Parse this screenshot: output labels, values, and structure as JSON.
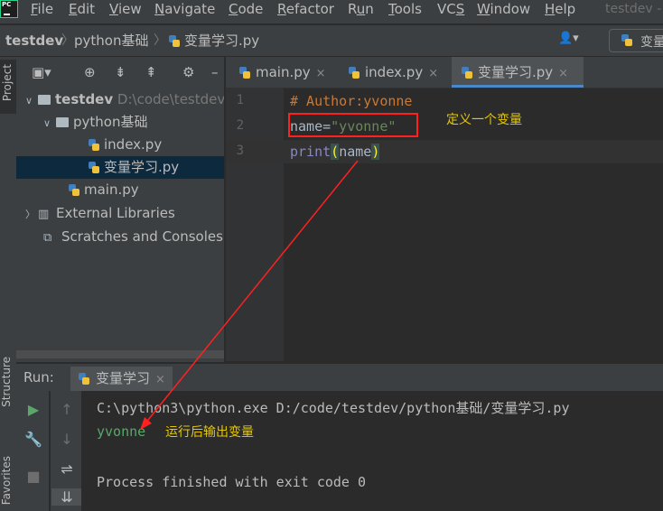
{
  "menubar": {
    "logo": "PC",
    "items": [
      {
        "pre": "",
        "u": "F",
        "post": "ile"
      },
      {
        "pre": "",
        "u": "E",
        "post": "dit"
      },
      {
        "pre": "",
        "u": "V",
        "post": "iew"
      },
      {
        "pre": "",
        "u": "N",
        "post": "avigate"
      },
      {
        "pre": "",
        "u": "C",
        "post": "ode"
      },
      {
        "pre": "",
        "u": "R",
        "post": "efactor"
      },
      {
        "pre": "R",
        "u": "u",
        "post": "n"
      },
      {
        "pre": "",
        "u": "T",
        "post": "ools"
      },
      {
        "pre": "VC",
        "u": "S",
        "post": ""
      },
      {
        "pre": "",
        "u": "W",
        "post": "indow"
      },
      {
        "pre": "",
        "u": "H",
        "post": "elp"
      }
    ],
    "window_title": "testdev -"
  },
  "breadcrumb": {
    "items": [
      "testdev",
      "python基础",
      "变量学习.py"
    ],
    "run_config_label": "变量"
  },
  "side_labels": {
    "project": "Project",
    "structure": "Structure",
    "favorites": "Favorites"
  },
  "project_tree": {
    "root_name": "testdev",
    "root_path": "D:\\code\\testdev",
    "folder": "python基础",
    "files": [
      "index.py",
      "变量学习.py"
    ],
    "main_file": "main.py",
    "external_libraries": "External Libraries",
    "scratches": "Scratches and Consoles"
  },
  "editor_tabs": [
    {
      "label": "main.py",
      "active": false
    },
    {
      "label": "index.py",
      "active": false
    },
    {
      "label": "变量学习.py",
      "active": true
    }
  ],
  "code": {
    "line_numbers": [
      "1",
      "2",
      "3"
    ],
    "line1_comment": "# Author:yvonne",
    "line2_name": "name",
    "line2_eq": "=",
    "line2_string": "\"yvonne\"",
    "line3_print": "print",
    "line3_open": "(",
    "line3_arg": "name",
    "line3_close": ")"
  },
  "annotations": {
    "define_variable": "定义一个变量",
    "output_variable": "运行后输出变量"
  },
  "run_panel": {
    "label": "Run:",
    "tab_label": "变量学习",
    "command": "C:\\python3\\python.exe D:/code/testdev/python基础/变量学习.py",
    "output": "yvonne",
    "exit_message": "Process finished with exit code 0"
  },
  "colors": {
    "annotation": "#e6c700",
    "highlight_box": "#ff2020",
    "run_green": "#59a869"
  }
}
